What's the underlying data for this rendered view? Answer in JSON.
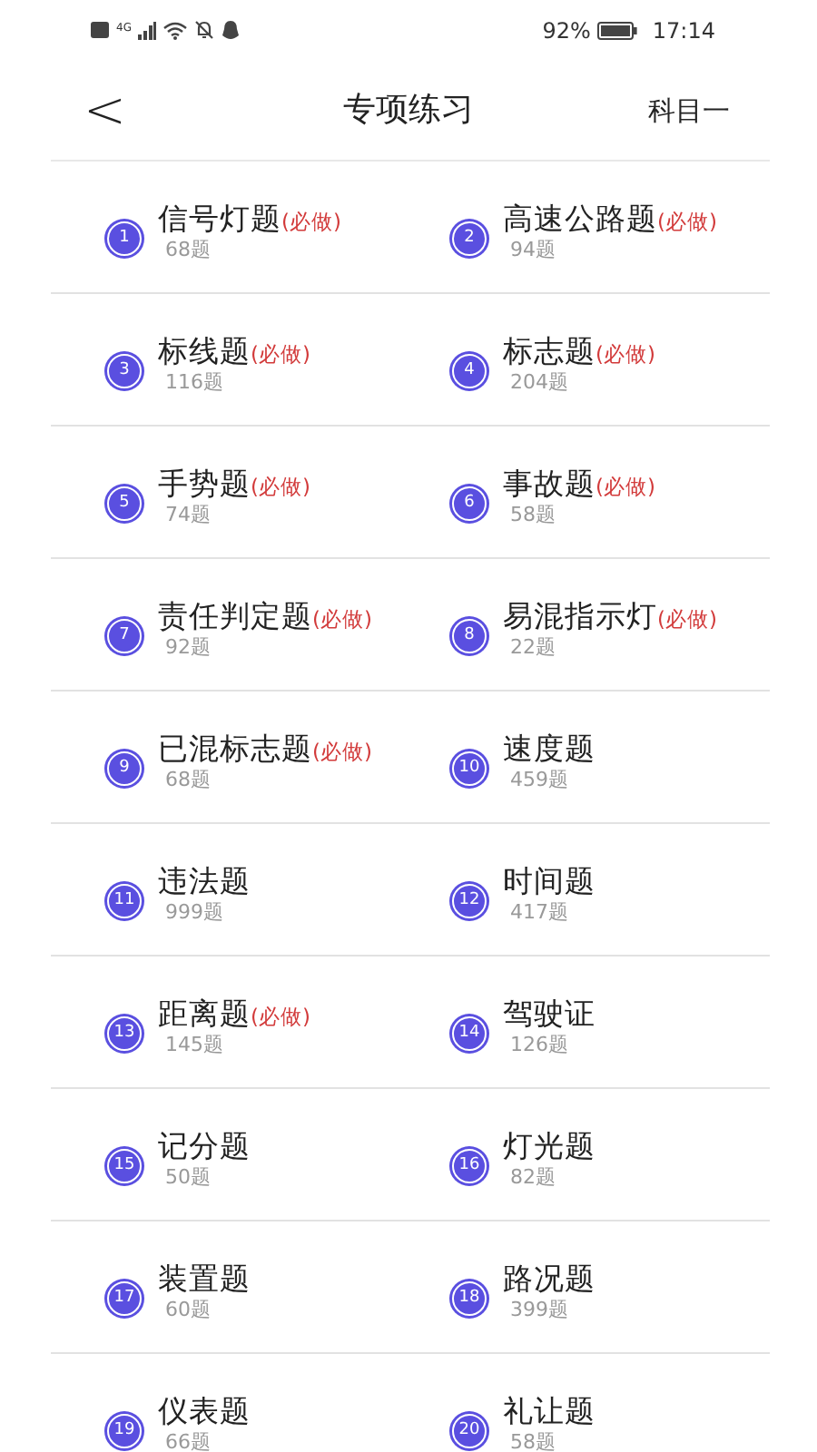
{
  "status_bar": {
    "network": "4G",
    "battery_percent": "92%",
    "time": "17:14"
  },
  "header": {
    "back": "<",
    "title": "专项练习",
    "subject": "科目一"
  },
  "items": [
    {
      "number": "1",
      "title": "信号灯题",
      "tag": "(必做)",
      "count": "68题"
    },
    {
      "number": "2",
      "title": "高速公路题",
      "tag": "(必做)",
      "count": "94题"
    },
    {
      "number": "3",
      "title": "标线题",
      "tag": "(必做)",
      "count": "116题"
    },
    {
      "number": "4",
      "title": "标志题",
      "tag": "(必做)",
      "count": "204题"
    },
    {
      "number": "5",
      "title": "手势题",
      "tag": "(必做)",
      "count": "74题"
    },
    {
      "number": "6",
      "title": "事故题",
      "tag": "(必做)",
      "count": "58题"
    },
    {
      "number": "7",
      "title": "责任判定题",
      "tag": "(必做)",
      "count": "92题"
    },
    {
      "number": "8",
      "title": "易混指示灯",
      "tag": "(必做)",
      "count": "22题"
    },
    {
      "number": "9",
      "title": "已混标志题",
      "tag": "(必做)",
      "count": "68题"
    },
    {
      "number": "10",
      "title": "速度题",
      "count": "459题"
    },
    {
      "number": "11",
      "title": "违法题",
      "count": "999题"
    },
    {
      "number": "12",
      "title": "时间题",
      "count": "417题"
    },
    {
      "number": "13",
      "title": "距离题",
      "tag": "(必做)",
      "count": "145题"
    },
    {
      "number": "14",
      "title": "驾驶证",
      "count": "126题"
    },
    {
      "number": "15",
      "title": "记分题",
      "count": "50题"
    },
    {
      "number": "16",
      "title": "灯光题",
      "count": "82题"
    },
    {
      "number": "17",
      "title": "装置题",
      "count": "60题"
    },
    {
      "number": "18",
      "title": "路况题",
      "count": "399题"
    },
    {
      "number": "19",
      "title": "仪表题",
      "count": "66题"
    },
    {
      "number": "20",
      "title": "礼让题",
      "count": "58题"
    }
  ]
}
